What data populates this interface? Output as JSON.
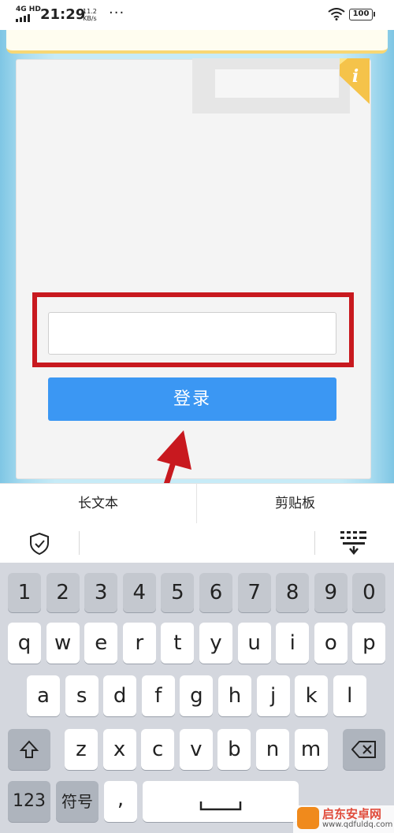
{
  "status_bar": {
    "network": "4G HD",
    "time": "21:29",
    "speed_value": "11.2",
    "speed_unit": "KB/s",
    "more": "···",
    "battery": "100"
  },
  "form": {
    "info_icon": "i",
    "login_label": "登录",
    "input_value": ""
  },
  "ime": {
    "tab_long_text": "长文本",
    "tab_clipboard": "剪贴板"
  },
  "keyboard": {
    "row_numbers": [
      "1",
      "2",
      "3",
      "4",
      "5",
      "6",
      "7",
      "8",
      "9",
      "0"
    ],
    "row_top": [
      "q",
      "w",
      "e",
      "r",
      "t",
      "y",
      "u",
      "i",
      "o",
      "p"
    ],
    "row_middle": [
      "a",
      "s",
      "d",
      "f",
      "g",
      "h",
      "j",
      "k",
      "l"
    ],
    "row_bottom": [
      "z",
      "x",
      "c",
      "v",
      "b",
      "n",
      "m"
    ],
    "key_123": "123",
    "key_symbols": "符号",
    "key_comma": ","
  },
  "watermark": {
    "title": "启东安卓网",
    "url": "www.qdfuldq.com"
  },
  "colors": {
    "accent_blue": "#3b97f3",
    "highlight_red": "#c8191f",
    "info_yellow": "#f5c34a"
  }
}
